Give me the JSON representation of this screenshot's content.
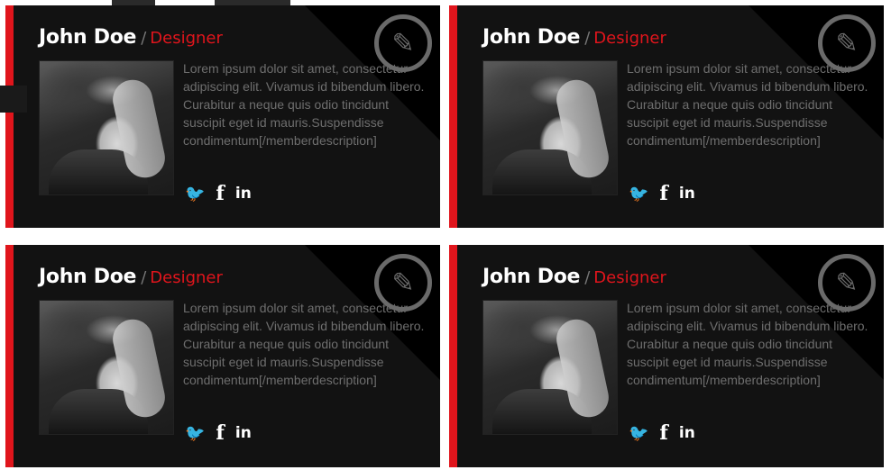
{
  "members": [
    {
      "name": "John Doe",
      "separator": "/",
      "role": "Designer",
      "description": "Lorem ipsum dolor sit amet, consectetur adipiscing elit. Vivamus id bibendum libero. Curabitur a neque quis odio tincidunt suscipit eget id mauris.Suspendisse condimentum[/memberdescription]",
      "social": {
        "twitter": "🐦",
        "facebook": "f",
        "linkedin": "in"
      },
      "edit_icon": "✎"
    },
    {
      "name": "John Doe",
      "separator": "/",
      "role": "Designer",
      "description": "Lorem ipsum dolor sit amet, consectetur adipiscing elit. Vivamus id bibendum libero. Curabitur a neque quis odio tincidunt suscipit eget id mauris.Suspendisse condimentum[/memberdescription]",
      "social": {
        "twitter": "🐦",
        "facebook": "f",
        "linkedin": "in"
      },
      "edit_icon": "✎"
    },
    {
      "name": "John Doe",
      "separator": "/",
      "role": "Designer",
      "description": "Lorem ipsum dolor sit amet, consectetur adipiscing elit. Vivamus id bibendum libero. Curabitur a neque quis odio tincidunt suscipit eget id mauris.Suspendisse condimentum[/memberdescription]",
      "social": {
        "twitter": "🐦",
        "facebook": "f",
        "linkedin": "in"
      },
      "edit_icon": "✎"
    },
    {
      "name": "John Doe",
      "separator": "/",
      "role": "Designer",
      "description": "Lorem ipsum dolor sit amet, consectetur adipiscing elit. Vivamus id bibendum libero. Curabitur a neque quis odio tincidunt suscipit eget id mauris.Suspendisse condimentum[/memberdescription]",
      "social": {
        "twitter": "🐦",
        "facebook": "f",
        "linkedin": "in"
      },
      "edit_icon": "✎"
    }
  ],
  "colors": {
    "accent": "#e0151c",
    "card_bg": "#121212",
    "text_muted": "#6e6e6e"
  }
}
